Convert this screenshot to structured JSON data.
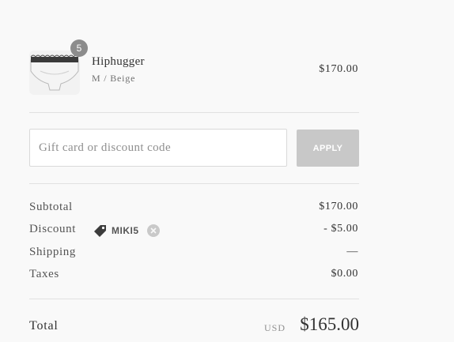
{
  "product": {
    "name": "Hiphugger",
    "variant": "M / Beige",
    "price": "$170.00",
    "quantity": "5",
    "image_icon": "lace-briefs-thumbnail"
  },
  "discount_form": {
    "placeholder": "Gift card or discount code",
    "value": "",
    "apply_label": "APPLY"
  },
  "totals": {
    "subtotal_label": "Subtotal",
    "subtotal_value": "$170.00",
    "discount_label": "Discount",
    "discount_code": "MIKI5",
    "discount_value": "- $5.00",
    "shipping_label": "Shipping",
    "shipping_value": "—",
    "taxes_label": "Taxes",
    "taxes_value": "$0.00",
    "total_label": "Total",
    "currency": "USD",
    "total_value": "$165.00"
  },
  "icons": {
    "tag": "tag-icon",
    "remove": "close-circle-icon"
  },
  "colors": {
    "apply_button": "#c8c8c8",
    "badge": "#8c8c8c",
    "background": "#f9f9f9"
  }
}
